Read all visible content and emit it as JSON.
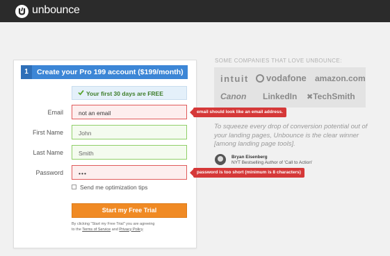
{
  "header": {
    "brand": "unbounce",
    "logo_icon": "unbounce-logo-icon"
  },
  "form": {
    "step_number": "1",
    "title": "Create your Pro 199 account ($199/month)",
    "free_banner": "Your first 30 days are FREE",
    "fields": {
      "email": {
        "label": "Email",
        "value": "not an email",
        "error": "email should look like an email address."
      },
      "first_name": {
        "label": "First Name",
        "value": "John"
      },
      "last_name": {
        "label": "Last Name",
        "value": "Smith"
      },
      "password": {
        "label": "Password",
        "value": "•••",
        "error": "password is too short (minimum is 8 characters)"
      }
    },
    "checkbox_label": "Send me optimization tips",
    "submit_label": "Start my Free Trial",
    "legal_prefix": "By clicking \"Start my Free Trial\" you are agreeing to the",
    "terms_link": "Terms of Service",
    "legal_and": "and",
    "privacy_link": "Privacy Policy",
    "legal_suffix": "."
  },
  "sidebar": {
    "companies_title": "SOME COMPANIES THAT LOVE UNBOUNCE:",
    "companies": [
      "intuit",
      "vodafone",
      "amazon.com",
      "Canon",
      "LinkedIn",
      "TechSmith"
    ],
    "quote": "To squeeze every drop of conversion potential out of your landing pages, Unbounce is the clear winner [among landing page tools].",
    "author_name": "Bryan Eisenberg",
    "author_title": "NYT Bestselling Author of 'Call to Action'"
  },
  "colors": {
    "topbar": "#2b2b2b",
    "header_blue": "#3c86d6",
    "cta_orange": "#f08a24",
    "error_red": "#d53838",
    "valid_green": "#8fcf68"
  }
}
